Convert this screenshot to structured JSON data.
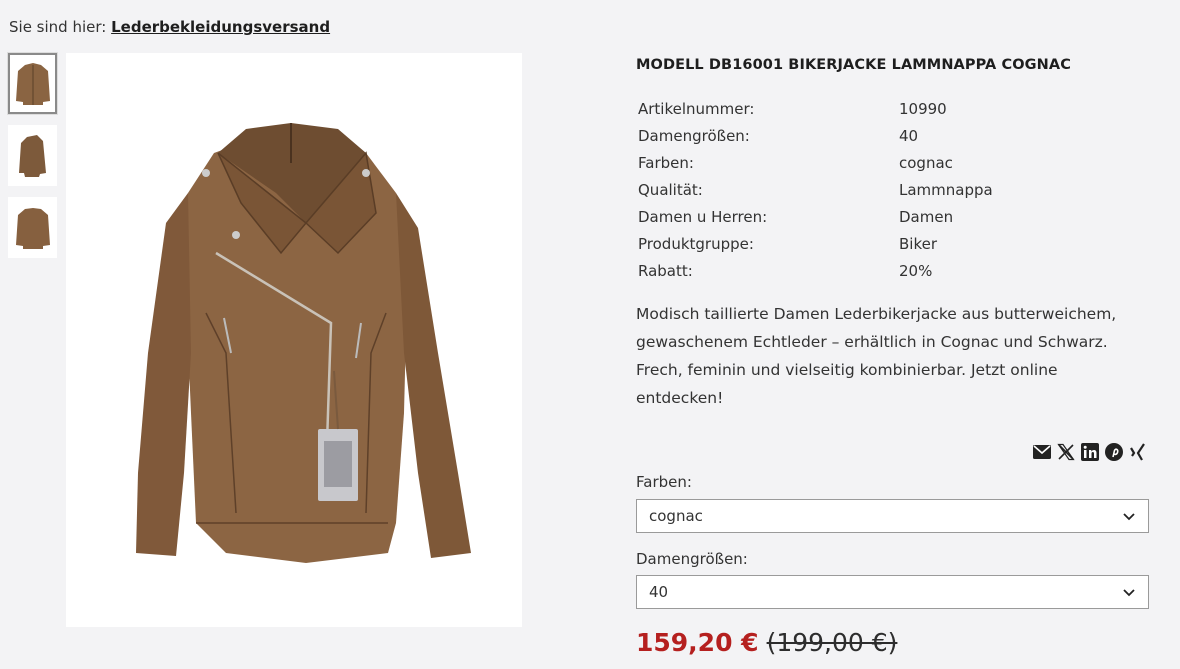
{
  "breadcrumb": {
    "prefix": "Sie sind hier:",
    "link": "Lederbekleidungsversand"
  },
  "gallery": {
    "thumbnails": [
      {
        "alt": "jacket-front"
      },
      {
        "alt": "jacket-side"
      },
      {
        "alt": "jacket-back"
      }
    ],
    "jacket_color": "#8a6442"
  },
  "product": {
    "title": "MODELL DB16001 BIKERJACKE LAMMNAPPA COGNAC",
    "specs": [
      {
        "label": "Artikelnummer:",
        "value": "10990"
      },
      {
        "label": "Damengrößen:",
        "value": "40"
      },
      {
        "label": "Farben:",
        "value": "cognac"
      },
      {
        "label": "Qualität:",
        "value": "Lammnappa"
      },
      {
        "label": "Damen u Herren:",
        "value": "Damen"
      },
      {
        "label": "Produktgruppe:",
        "value": "Biker"
      },
      {
        "label": "Rabatt:",
        "value": "20%"
      }
    ],
    "description": "Modisch taillierte Damen Lederbikerjacke aus butterweichem, gewaschenem Echtleder – erhältlich in Cognac und Schwarz. Frech, feminin und vielseitig kombinierbar. Jetzt online entdecken!"
  },
  "share_icons": [
    "mail-icon",
    "x-icon",
    "linkedin-icon",
    "pinterest-icon",
    "xing-icon"
  ],
  "options": {
    "color_label": "Farben:",
    "color_value": "cognac",
    "size_label": "Damengrößen:",
    "size_value": "40"
  },
  "price": {
    "current": "159,20 €",
    "original": "(199,00 €)",
    "accent": "#b5201f"
  }
}
